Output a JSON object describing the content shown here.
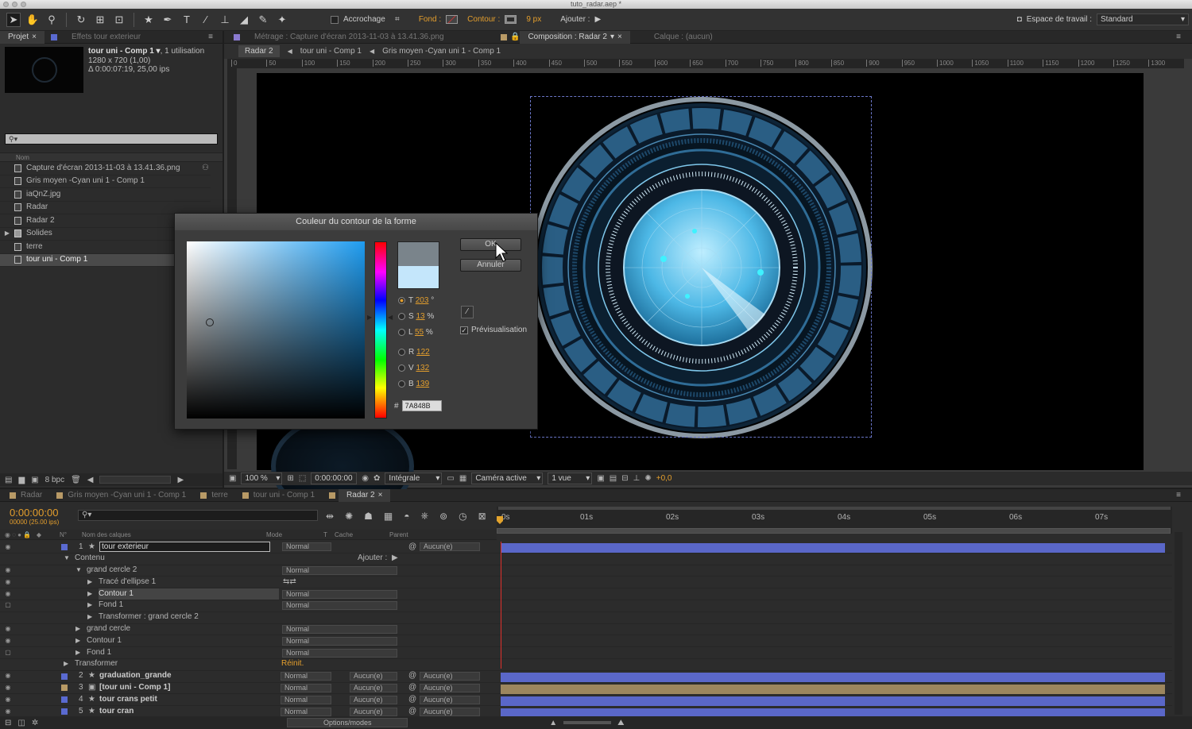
{
  "window": {
    "title": "tuto_radar.aep *"
  },
  "toolbar": {
    "snap_label": "Accrochage",
    "fill_label": "Fond :",
    "stroke_label": "Contour :",
    "stroke_width": "9 px",
    "add_label": "Ajouter :",
    "workspace_label": "Espace de travail :",
    "workspace_value": "Standard"
  },
  "project_panel": {
    "tabs": [
      "Projet",
      "Effets tour exterieur"
    ],
    "preview_name": "tour uni - Comp 1 ▾",
    "preview_usage": ", 1 utilisation",
    "preview_dims": "1280 x 720 (1,00)",
    "preview_duration": "Δ 0:00:07:19, 25,00 ips",
    "column_name": "Nom",
    "items": [
      {
        "label": "Capture d'écran 2013-11-03 à 13.41.36.png"
      },
      {
        "label": "Gris moyen -Cyan uni 1 - Comp 1"
      },
      {
        "label": "iaQnZ.jpg"
      },
      {
        "label": "Radar"
      },
      {
        "label": "Radar 2"
      },
      {
        "label": "Solides"
      },
      {
        "label": "terre"
      },
      {
        "label": "tour uni - Comp 1"
      }
    ],
    "bpc": "8 bpc"
  },
  "viewer": {
    "tabs": [
      "Métrage : Capture d'écran 2013-11-03 à 13.41.36.png",
      "Composition : Radar 2",
      "Calque : (aucun)"
    ],
    "breadcrumbs": [
      "Radar 2",
      "tour uni - Comp 1",
      "Gris moyen -Cyan uni 1 - Comp 1"
    ],
    "ruler_ticks": [
      "0",
      "50",
      "100",
      "150",
      "200",
      "250",
      "300",
      "350",
      "400",
      "450",
      "500",
      "550",
      "600",
      "650",
      "700",
      "750",
      "800",
      "850",
      "900",
      "950",
      "1000",
      "1050",
      "1100",
      "1150",
      "1200",
      "1250",
      "1300"
    ],
    "zoom": "100 %",
    "timecode": "0:00:00:00",
    "resolution": "Intégrale",
    "camera": "Caméra active",
    "views": "1 vue",
    "exposure": "+0,0"
  },
  "color_dialog": {
    "title": "Couleur du contour de la forme",
    "ok_label": "OK",
    "cancel_label": "Annuler",
    "preview_label": "Prévisualisation",
    "fields": [
      {
        "key": "T",
        "value": "203",
        "unit": "°"
      },
      {
        "key": "S",
        "value": "13",
        "unit": "%"
      },
      {
        "key": "L",
        "value": "55",
        "unit": "%"
      },
      {
        "key": "R",
        "value": "122",
        "unit": ""
      },
      {
        "key": "V",
        "value": "132",
        "unit": ""
      },
      {
        "key": "B",
        "value": "139",
        "unit": ""
      }
    ],
    "hex_prefix": "#",
    "hex": "7A848B",
    "new_color": "#7a848b",
    "old_color": "#c4e6fb"
  },
  "timeline": {
    "tabs": [
      "Radar",
      "Gris moyen -Cyan uni 1 - Comp 1",
      "terre",
      "tour uni - Comp 1",
      "Radar 2"
    ],
    "timecode": "0:00:00:00",
    "frame_info": "00000 (25.00 ips)",
    "columns": {
      "num": "N°",
      "name": "Nom des calques",
      "mode": "Mode",
      "t": "T",
      "mask": "Cache",
      "parent": "Parent"
    },
    "time_ticks": [
      "0s",
      "01s",
      "02s",
      "03s",
      "04s",
      "05s",
      "06s",
      "07s"
    ],
    "add_label": "Ajouter :",
    "reset_label": "Réinit.",
    "toggle_label": "Options/modes",
    "rows": [
      {
        "num": "1",
        "name": "tour exterieur",
        "mode": "Normal",
        "parent": "Aucun(e)"
      },
      {
        "name": "Contenu"
      },
      {
        "name": "grand cercle 2",
        "mode": "Normal"
      },
      {
        "name": "Tracé d'ellipse 1"
      },
      {
        "name": "Contour 1",
        "mode": "Normal"
      },
      {
        "name": "Fond 1",
        "mode": "Normal"
      },
      {
        "name": "Transformer : grand cercle 2"
      },
      {
        "name": "grand cercle",
        "mode": "Normal"
      },
      {
        "name": "Contour 1",
        "mode": "Normal"
      },
      {
        "name": "Fond 1",
        "mode": "Normal"
      },
      {
        "name": "Transformer"
      },
      {
        "num": "2",
        "name": "graduation_grande",
        "mode": "Normal",
        "mask": "Aucun(e)",
        "parent": "Aucun(e)"
      },
      {
        "num": "3",
        "name": "[tour uni - Comp 1]",
        "mode": "Normal",
        "mask": "Aucun(e)",
        "parent": "Aucun(e)"
      },
      {
        "num": "4",
        "name": "tour crans petit",
        "mode": "Normal",
        "mask": "Aucun(e)",
        "parent": "Aucun(e)"
      },
      {
        "num": "5",
        "name": "tour cran",
        "mode": "Normal",
        "mask": "Aucun(e)",
        "parent": "Aucun(e)"
      }
    ],
    "colors": {
      "layer_bar": "#5a67c8",
      "precomp_bar": "#9c865e",
      "playhead": "#e0302c"
    }
  }
}
